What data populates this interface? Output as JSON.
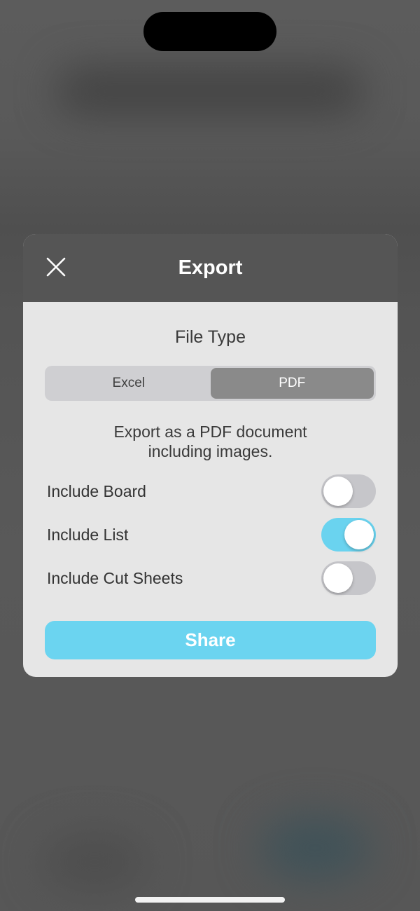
{
  "dialog": {
    "title": "Export",
    "close_icon": "close-icon"
  },
  "file_type": {
    "label": "File Type",
    "options": [
      "Excel",
      "PDF"
    ],
    "selected": "PDF",
    "description_line1": "Export as a PDF document",
    "description_line2": "including images."
  },
  "options": [
    {
      "label": "Include Board",
      "enabled": false
    },
    {
      "label": "Include List",
      "enabled": true
    },
    {
      "label": "Include Cut Sheets",
      "enabled": false
    }
  ],
  "share_button": {
    "label": "Share"
  },
  "colors": {
    "accent": "#6bd4f0",
    "header_bg": "#555555",
    "body_bg": "#e6e6e6",
    "segment_selected": "#8a8a8a",
    "toggle_off": "#c6c6ca"
  }
}
